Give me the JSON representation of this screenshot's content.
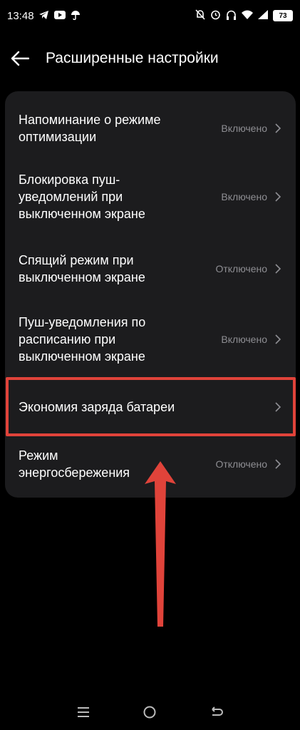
{
  "status": {
    "time": "13:48",
    "battery": "73"
  },
  "header": {
    "title": "Расширенные настройки"
  },
  "settings": [
    {
      "label": "Напоминание о режиме оптимизации",
      "value": "Включено"
    },
    {
      "label": "Блокировка пуш-уведомлений при выключенном экране",
      "value": "Включено"
    },
    {
      "label": "Спящий режим при выключенном экране",
      "value": "Отключено"
    },
    {
      "label": "Пуш-уведомления по расписанию при выключенном экране",
      "value": "Включено"
    },
    {
      "label": "Экономия заряда батареи",
      "value": ""
    },
    {
      "label": "Режим энергосбережения",
      "value": "Отключено"
    }
  ],
  "colors": {
    "background": "#000000",
    "card": "#1c1c1e",
    "secondary_text": "#8e8e93",
    "highlight": "#e0433a"
  },
  "icons": [
    "back-arrow-icon",
    "chevron-right-icon",
    "menu-icon",
    "home-icon",
    "back-icon"
  ]
}
